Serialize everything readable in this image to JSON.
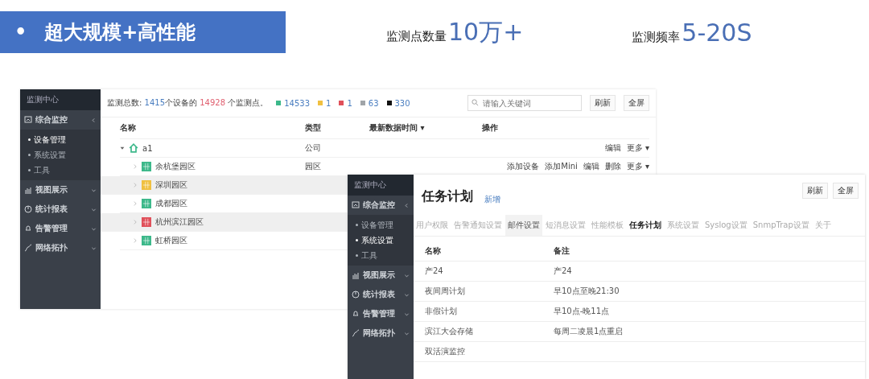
{
  "header": {
    "bullet": "•",
    "title": "超大规模+高性能",
    "stats": [
      {
        "label": "监测点数量",
        "value": "10万+"
      },
      {
        "label": "监测频率",
        "value": "5-20S"
      }
    ]
  },
  "screens": [
    {
      "sidebar": {
        "title": "监测中心",
        "groups": [
          {
            "label": "综合监控",
            "expanded": true,
            "children": [
              {
                "label": "设备管理",
                "selected": true
              },
              {
                "label": "系统设置",
                "selected": false
              },
              {
                "label": "工具",
                "selected": false
              }
            ]
          },
          {
            "label": "视图展示",
            "expanded": false
          },
          {
            "label": "统计报表",
            "expanded": false
          },
          {
            "label": "告警管理",
            "expanded": false
          },
          {
            "label": "网络拓扑",
            "expanded": false
          }
        ]
      },
      "summary": "监测总数: **1415**个设备的 *14928* 个监测点。",
      "legend": [
        {
          "count": "14533",
          "color": "#3cb88a"
        },
        {
          "count": "1",
          "color": "#f0c040"
        },
        {
          "count": "1",
          "color": "#e0505a"
        },
        {
          "count": "63",
          "color": "#a0a4a8"
        },
        {
          "count": "330",
          "color": "#111111"
        }
      ],
      "search": {
        "placeholder": "请输入关键词"
      },
      "buttons": [
        "刷新",
        "全屏"
      ],
      "table": {
        "columns": [
          "名称",
          "类型",
          "最新数据时间 ▾",
          "操作"
        ],
        "rows": [
          {
            "name": "a1",
            "kind": "company",
            "type": "公司",
            "actions": [
              "编辑",
              "更多 ▾"
            ],
            "highlighted": false,
            "expanded": true,
            "children": [
              {
                "name": "余杭堡园区",
                "kind": "park",
                "color": "#3cb88a",
                "type": "园区",
                "actions": [
                  "添加设备",
                  "添加Mini",
                  "编辑",
                  "删除",
                  "更多 ▾"
                ],
                "highlighted": false,
                "expanded": false
              },
              {
                "name": "深圳园区",
                "kind": "park",
                "color": "#f0c040",
                "highlighted": true,
                "expanded": false
              },
              {
                "name": "成都园区",
                "kind": "park",
                "color": "#3cb88a",
                "highlighted": false,
                "expanded": false
              },
              {
                "name": "杭州滨江园区",
                "kind": "park",
                "color": "#e0505a",
                "highlighted": true,
                "expanded": false
              },
              {
                "name": "虹桥园区",
                "kind": "park",
                "color": "#3cb88a",
                "highlighted": false,
                "expanded": false
              }
            ]
          }
        ]
      }
    },
    {
      "sidebar": {
        "title": "监测中心",
        "groups": [
          {
            "label": "综合监控",
            "expanded": true,
            "children": [
              {
                "label": "设备管理",
                "selected": false
              },
              {
                "label": "系统设置",
                "selected": true
              },
              {
                "label": "工具",
                "selected": false
              }
            ]
          },
          {
            "label": "视图展示",
            "expanded": false
          },
          {
            "label": "统计报表",
            "expanded": false
          },
          {
            "label": "告警管理",
            "expanded": false
          },
          {
            "label": "网络拓扑",
            "expanded": false
          }
        ]
      },
      "page_title": "任务计划",
      "link": "新增",
      "buttons": [
        "刷新",
        "全屏"
      ],
      "tabs": [
        {
          "label": "用户权限",
          "selected": false,
          "highlighted": false
        },
        {
          "label": "告警通知设置",
          "selected": false,
          "highlighted": false
        },
        {
          "label": "邮件设置",
          "selected": false,
          "highlighted": true
        },
        {
          "label": "短消息设置",
          "selected": false,
          "highlighted": false
        },
        {
          "label": "性能模板",
          "selected": false,
          "highlighted": false
        },
        {
          "label": "任务计划",
          "selected": true,
          "highlighted": false
        },
        {
          "label": "系统设置",
          "selected": false,
          "highlighted": false
        },
        {
          "label": "Syslog设置",
          "selected": false,
          "highlighted": false
        },
        {
          "label": "SnmpTrap设置",
          "selected": false,
          "highlighted": false
        },
        {
          "label": "关于",
          "selected": false,
          "highlighted": false
        }
      ],
      "table": {
        "columns": [
          "名称",
          "备注"
        ],
        "rows": [
          [
            "产24",
            "产24"
          ],
          [
            "夜间周计划",
            "早10点至晚21:30"
          ],
          [
            "非假计划",
            "早10点-晚11点"
          ],
          [
            "滨江大会存储",
            "每周二凌晨1点重启"
          ],
          [
            "双活演监控",
            ""
          ]
        ]
      }
    }
  ]
}
